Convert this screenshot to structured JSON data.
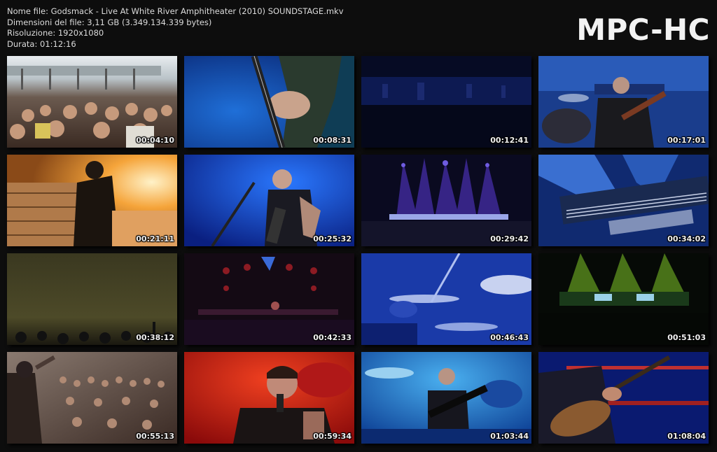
{
  "info": {
    "filename": "Nome file: Godsmack - Live At White River Amphitheater (2010) SOUNDSTAGE.mkv",
    "filesize": "Dimensioni del file: 3,11 GB (3.349.134.339 bytes)",
    "resolution": "Risoluzione: 1920x1080",
    "duration": "Durata: 01:12:16"
  },
  "logo": "MPC-HC",
  "thumbnails": [
    {
      "time": "00:04:10",
      "scene": "crowd-daylight"
    },
    {
      "time": "00:08:31",
      "scene": "guitarist-closeup-blue"
    },
    {
      "time": "00:12:41",
      "scene": "dark-stage-blue"
    },
    {
      "time": "00:17:01",
      "scene": "guitarist-drums-blue"
    },
    {
      "time": "00:21:11",
      "scene": "guitarist-fire"
    },
    {
      "time": "00:25:32",
      "scene": "singer-mic-blue"
    },
    {
      "time": "00:29:42",
      "scene": "stage-lights-wide"
    },
    {
      "time": "00:34:02",
      "scene": "guitar-hands-blue"
    },
    {
      "time": "00:38:12",
      "scene": "crowd-dark-haze"
    },
    {
      "time": "00:42:33",
      "scene": "stage-red-wide"
    },
    {
      "time": "00:46:43",
      "scene": "drum-cymbals-blue"
    },
    {
      "time": "00:51:03",
      "scene": "stage-green-lights"
    },
    {
      "time": "00:55:13",
      "scene": "crowd-singer-side"
    },
    {
      "time": "00:59:34",
      "scene": "singer-red"
    },
    {
      "time": "01:03:44",
      "scene": "guitarist-stage-blue"
    },
    {
      "time": "01:08:04",
      "scene": "guitar-closeup-blue"
    }
  ]
}
